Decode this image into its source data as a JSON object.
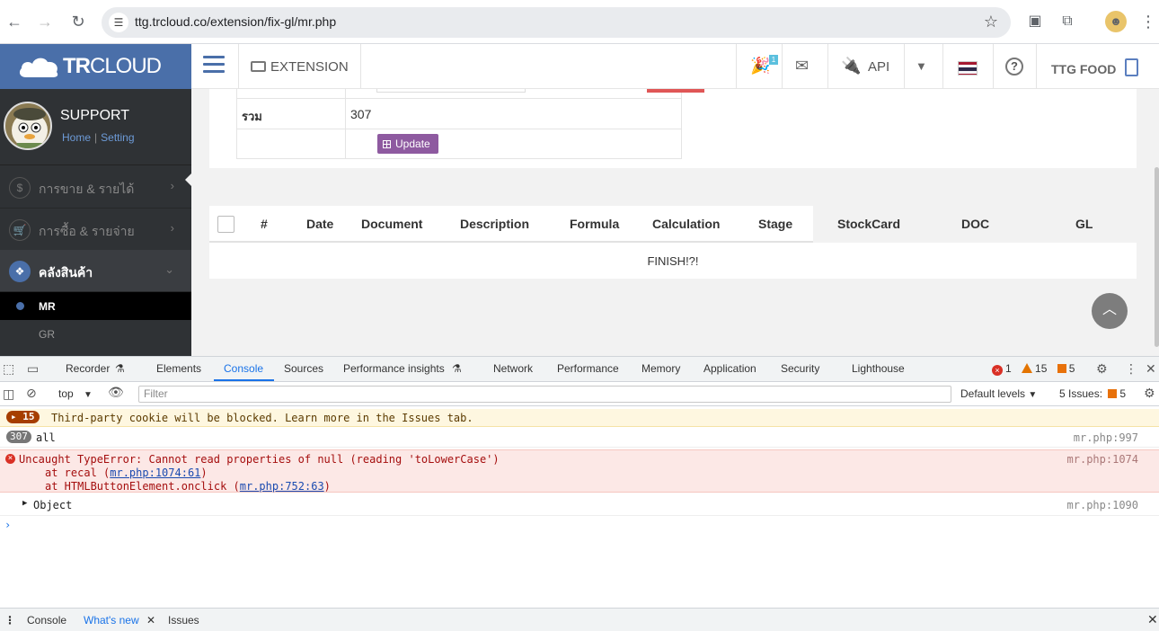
{
  "browser": {
    "url": "ttg.trcloud.co/extension/fix-gl/mr.php"
  },
  "app": {
    "logo_bold": "TR",
    "logo_rest": "CLOUD",
    "extension_label": "EXTENSION",
    "notification_count": "1",
    "api_label": "API",
    "company_name": "TTG FOOD"
  },
  "sidebar": {
    "user_name": "SUPPORT",
    "home_link": "Home",
    "setting_link": "Setting",
    "items": [
      {
        "label": "การขาย & รายได้",
        "icon": "$"
      },
      {
        "label": "การซื้อ & รายจ่าย",
        "icon": "cart"
      },
      {
        "label": "คลังสินค้า",
        "icon": "cubes"
      }
    ],
    "subitems": [
      "MR",
      "GR"
    ]
  },
  "summary": {
    "total_label": "รวม",
    "total_value": "307",
    "update_button": "Update"
  },
  "table": {
    "headers": [
      "#",
      "Date",
      "Document",
      "Description",
      "Formula",
      "Calculation",
      "Stage",
      "StockCard",
      "DOC",
      "GL"
    ],
    "finish_text": "FINISH!?!"
  },
  "devtools": {
    "tabs": [
      "Recorder",
      "Elements",
      "Console",
      "Sources",
      "Performance insights",
      "Network",
      "Performance",
      "Memory",
      "Application",
      "Security",
      "Lighthouse"
    ],
    "active_tab": "Console",
    "error_count": "1",
    "warning_count": "15",
    "info_count": "5",
    "context": "top",
    "filter_placeholder": "Filter",
    "levels": "Default levels",
    "issues_label": "5 Issues:",
    "issues_count": "5",
    "messages": {
      "cookie_count": "15",
      "cookie_text": "Third-party cookie will be blocked. Learn more in the Issues tab.",
      "log_count": "307",
      "log_text": "all",
      "log_src": "mr.php:997",
      "error_line1": "Uncaught TypeError: Cannot read properties of null (reading 'toLowerCase')",
      "error_line2_prefix": "at recal (",
      "error_line2_link": "mr.php:1074:61",
      "error_line2_suffix": ")",
      "error_line3_prefix": "at HTMLButtonElement.onclick (",
      "error_line3_link": "mr.php:752:63",
      "error_line3_suffix": ")",
      "error_src": "mr.php:1074",
      "object_text": "Object",
      "object_src": "mr.php:1090",
      "prompt": "›"
    },
    "drawer_tabs": [
      "Console",
      "What's new",
      "Issues"
    ]
  }
}
